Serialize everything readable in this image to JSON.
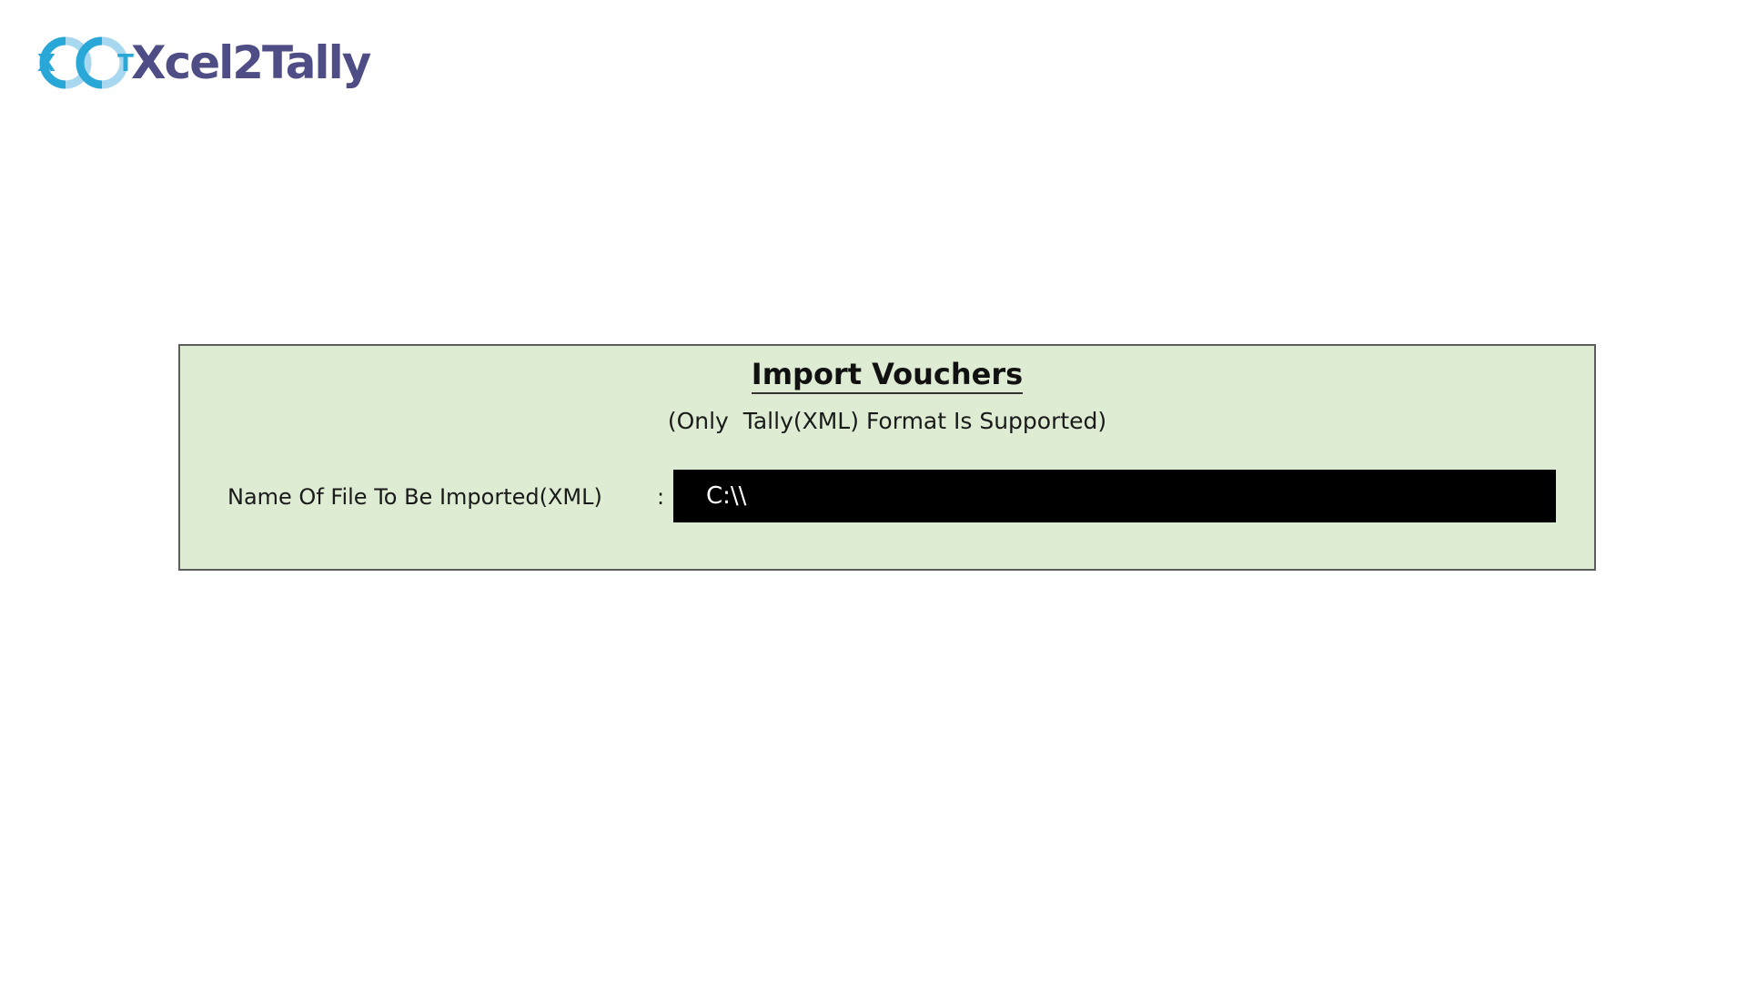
{
  "logo": {
    "text": "Xcel2Tally",
    "mark_letters": [
      "X",
      "T"
    ],
    "colors": {
      "text": "#4e4d86",
      "ring_dark": "#29a8d8",
      "ring_light": "#a8d8ef"
    }
  },
  "dialog": {
    "title": "Import Vouchers",
    "subtitle": "(Only  Tally(XML) Format Is Supported)",
    "field": {
      "label": "Name Of File To Be Imported(XML)",
      "separator": ":",
      "value": "C:\\\\"
    },
    "colors": {
      "background": "#deecd3",
      "border": "#5d5d5d",
      "input_background": "#000000",
      "input_text": "#ffffff"
    }
  }
}
